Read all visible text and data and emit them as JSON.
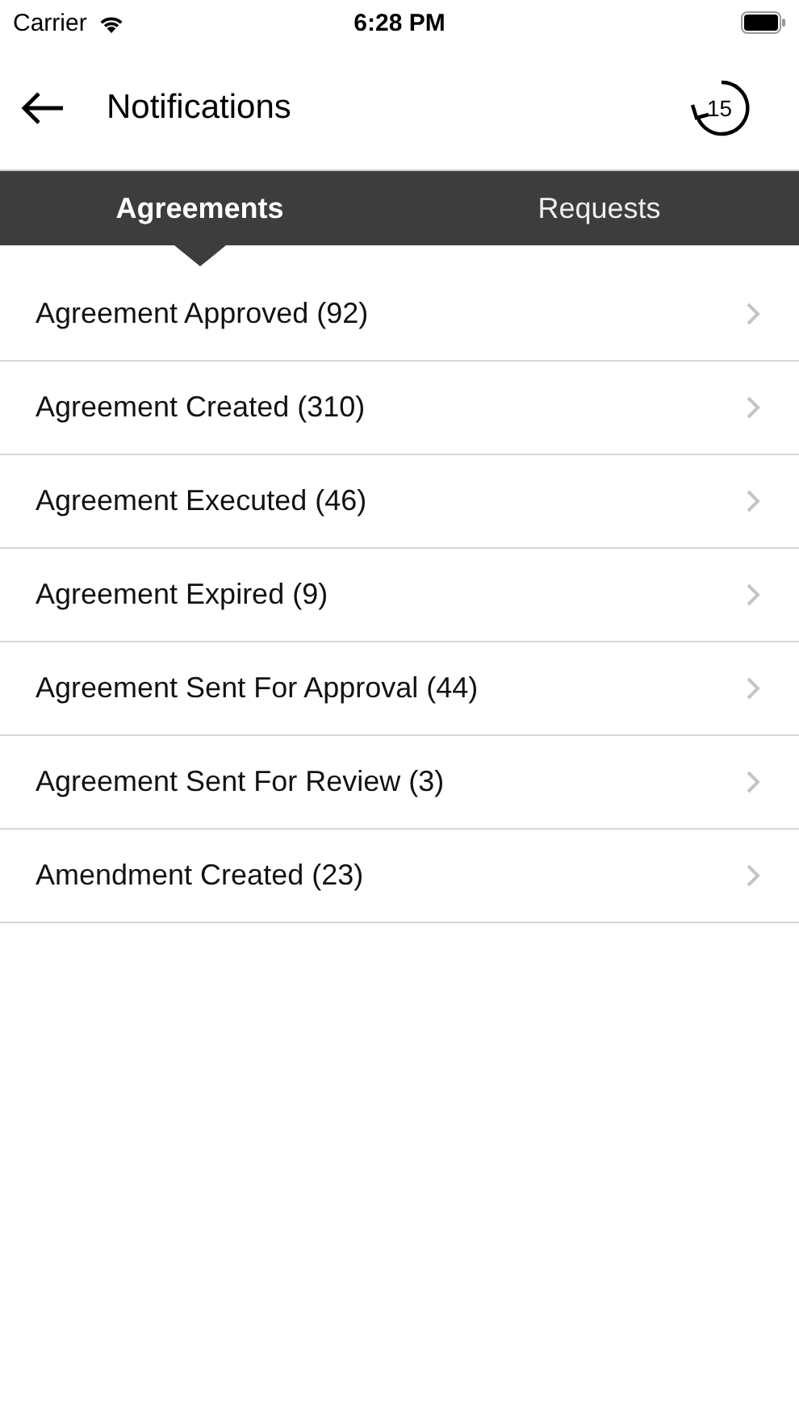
{
  "status_bar": {
    "carrier": "Carrier",
    "time": "6:28 PM"
  },
  "header": {
    "title": "Notifications",
    "replay_count": "15"
  },
  "tabs": [
    {
      "label": "Agreements",
      "selected": true
    },
    {
      "label": "Requests",
      "selected": false
    }
  ],
  "items": [
    {
      "label": "Agreement Approved (92)"
    },
    {
      "label": "Agreement Created (310)"
    },
    {
      "label": "Agreement Executed (46)"
    },
    {
      "label": "Agreement Expired (9)"
    },
    {
      "label": "Agreement Sent For Approval (44)"
    },
    {
      "label": "Agreement Sent For Review (3)"
    },
    {
      "label": "Amendment Created (23)"
    }
  ]
}
